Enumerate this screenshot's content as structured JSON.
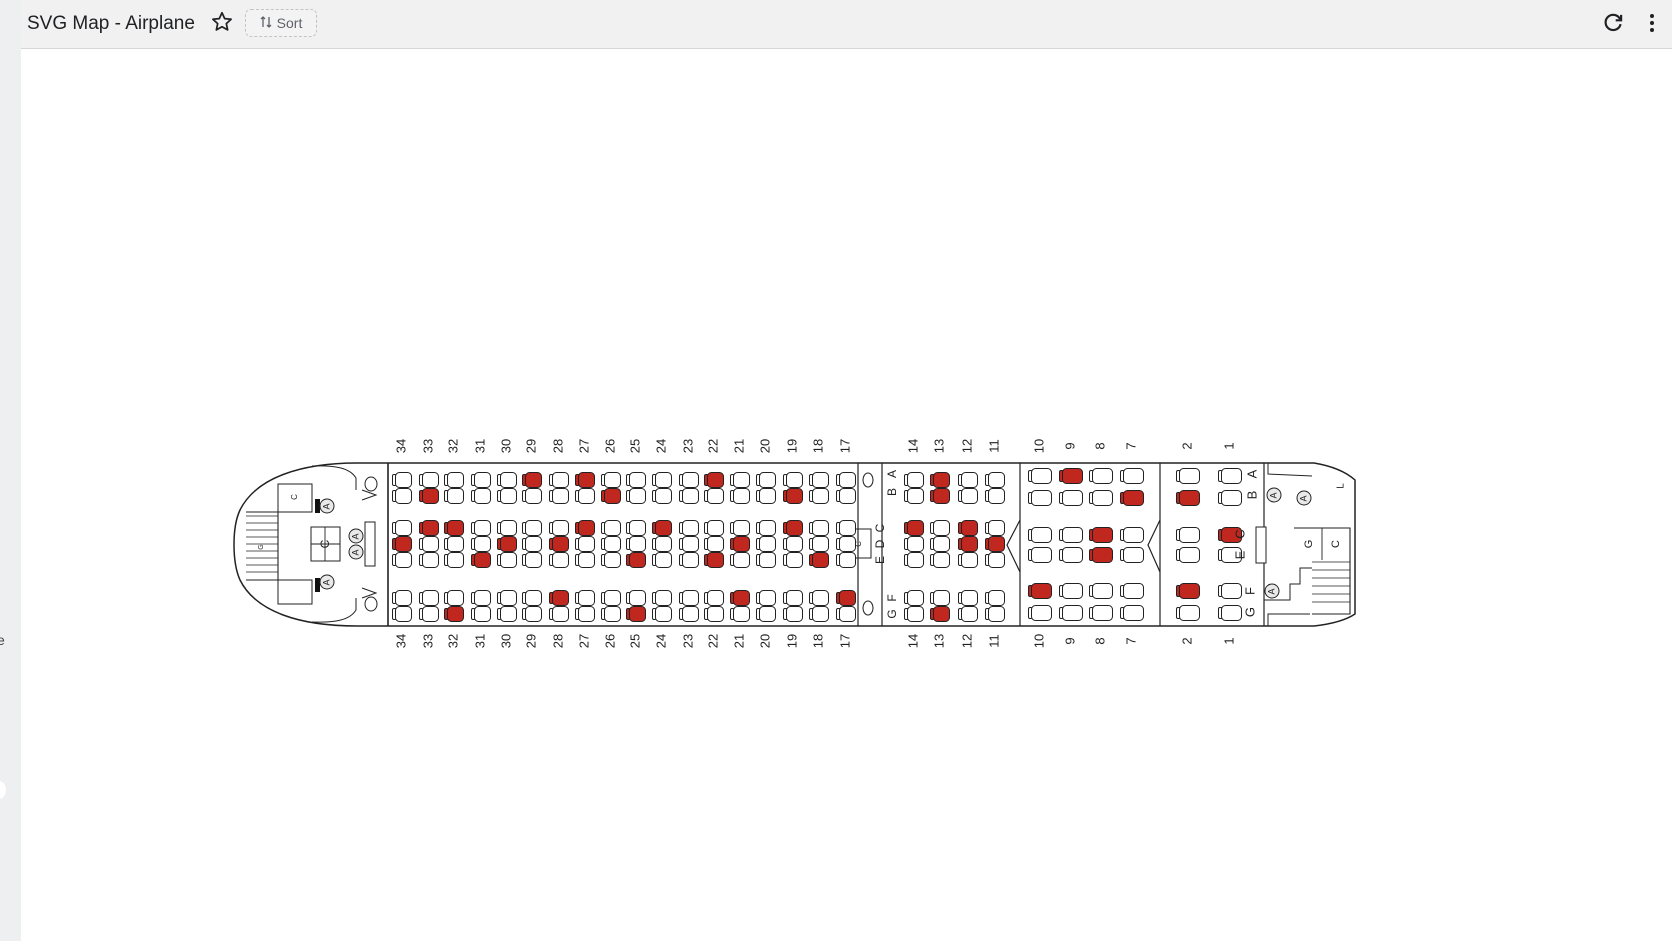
{
  "header": {
    "title": "SVG Map - Airplane",
    "sort_label": "Sort",
    "icons": [
      "star-icon",
      "sort-icon",
      "refresh-icon",
      "more-vert-icon"
    ]
  },
  "colors": {
    "occupied": "#c0271f",
    "available": "#ffffff",
    "outline": "#222222"
  },
  "seatmap": {
    "rows_economy": [
      34,
      33,
      32,
      31,
      30,
      29,
      28,
      27,
      26,
      25,
      24,
      23,
      22,
      21,
      20,
      19,
      18,
      17
    ],
    "rows_premium": [
      14,
      13,
      12,
      11
    ],
    "rows_business": [
      10,
      9,
      8,
      7
    ],
    "rows_first": [
      2,
      1
    ],
    "premium_letters_left": [
      "B",
      "A"
    ],
    "premium_letters_center": [
      "C",
      "D",
      "E"
    ],
    "premium_letters_right": [
      "G",
      "F"
    ],
    "first_letters_left": [
      "A",
      "B"
    ],
    "first_letters_center": [
      "C",
      "E"
    ],
    "first_letters_right": [
      "F",
      "G"
    ],
    "occupied": {
      "economy": {
        "A": [
          29,
          27,
          22
        ],
        "B": [
          33,
          26,
          19
        ],
        "C": [
          33,
          32,
          27,
          24,
          19
        ],
        "D": [
          34,
          30,
          28,
          21
        ],
        "E": [
          31,
          25,
          22,
          18
        ],
        "F": [
          28,
          21,
          17
        ],
        "G": [
          32,
          25
        ]
      },
      "premium": {
        "A": [
          13
        ],
        "B": [
          13
        ],
        "C": [
          14,
          12
        ],
        "D": [
          12,
          11
        ],
        "E": [],
        "F": [],
        "G": [
          13
        ]
      },
      "business": {
        "A": [
          9
        ],
        "B": [
          7
        ],
        "C": [
          8
        ],
        "E": [
          8
        ],
        "F": [
          10
        ],
        "G": []
      },
      "first": {
        "B": [
          2
        ],
        "C": [
          1
        ],
        "F": [
          2
        ]
      }
    },
    "galley_labels": [
      "G",
      "C",
      "C",
      "G",
      "C",
      "C",
      "A",
      "L"
    ]
  }
}
